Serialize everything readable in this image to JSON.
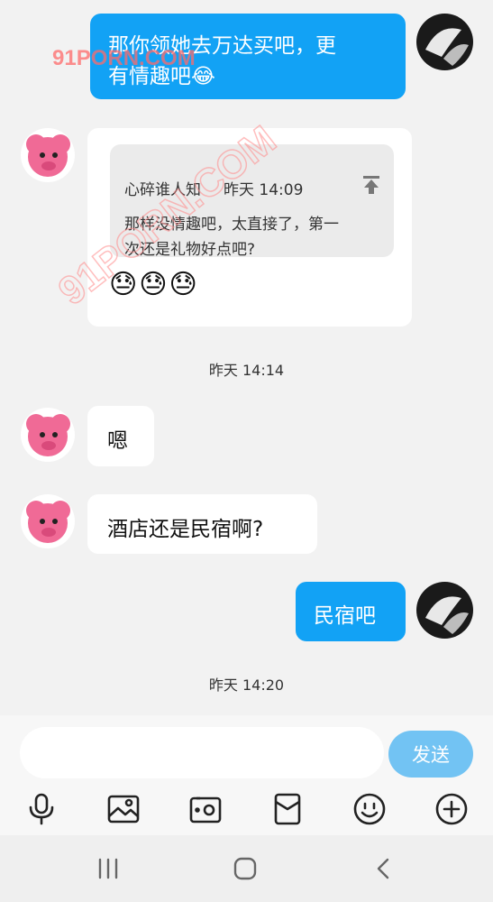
{
  "messages": {
    "m1": {
      "text_line1": "那你领她去万达买吧，更",
      "text_line2": "有情趣吧😂"
    },
    "m2": {
      "quote_author": "心碎谁人知",
      "quote_time": "昨天 14:09",
      "quote_text_line1": "那样没情趣吧，太直接了，第一",
      "quote_text_line2": "次还是礼物好点吧?",
      "emojis": "😓😓😓"
    },
    "timestamp1": "昨天 14:14",
    "m3": {
      "text": "嗯"
    },
    "m4": {
      "text": "酒店还是民宿啊?"
    },
    "m5": {
      "text": "民宿吧"
    },
    "timestamp2": "昨天 14:20"
  },
  "input": {
    "value": "",
    "send_label": "发送"
  },
  "toolbar": [
    "mic-icon",
    "image-icon",
    "camera-icon",
    "red-packet-icon",
    "emoji-icon",
    "plus-icon"
  ],
  "navbar": [
    "recents-icon",
    "home-icon",
    "back-icon"
  ],
  "watermark": "91PORN.COM",
  "colors": {
    "accent": "#12a2f5",
    "send_button": "#72c3f3",
    "background": "#f2f2f2"
  }
}
